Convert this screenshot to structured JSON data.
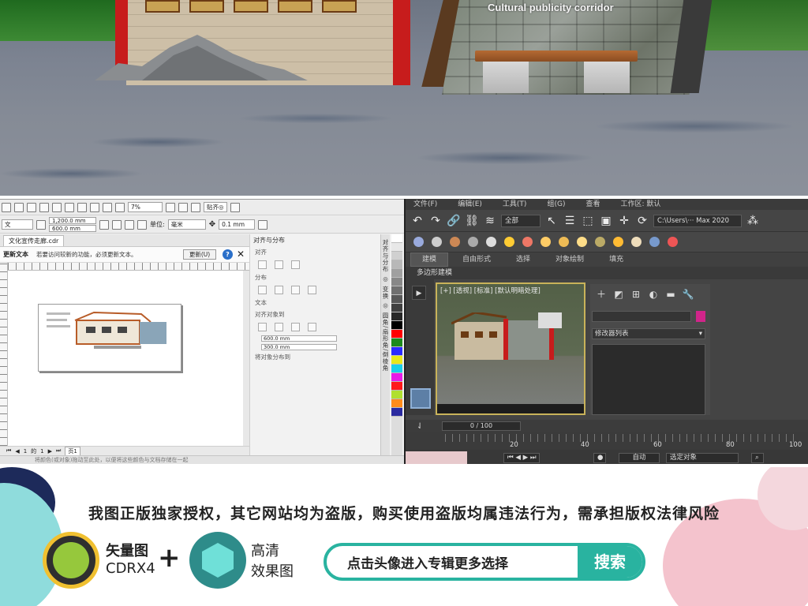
{
  "scene": {
    "caption": "Cultural publicity corridor"
  },
  "corel": {
    "toolbar": {
      "zoom": "7%",
      "align_label": "贴齐◎",
      "width": "1,200.0 mm",
      "height": "600.0 mm",
      "units_label": "单位:",
      "units_value": "毫米",
      "nudge": "0.1 mm"
    },
    "doc_tab": "文化宣传走廊.cdr",
    "notify": {
      "title": "更新文本",
      "message": "若要访问较新的功能，必须更新文本。",
      "button": "更新(U)"
    },
    "ruler_marks": [
      "200",
      "0",
      "200",
      "400",
      "600",
      "800",
      "1000",
      "1200",
      "1400"
    ],
    "pager": {
      "current": "1",
      "of": "1",
      "page_tab": "页1"
    },
    "status": "将颜色(或对象)拖动至此处，以便将这些颜色与文档存储在一起",
    "dock": {
      "title": "对齐与分布",
      "align": "对齐",
      "distribute": "分布",
      "text": "文本",
      "align_to": "对齐对象到",
      "x_value": "600.0 mm",
      "y_value": "300.0 mm",
      "distribute_to": "将对象分布到"
    },
    "dock_tabs": "对齐与分布 ◎ 变换 ◎ 圆角/扇形角/倒棱角"
  },
  "palette": [
    "#ffffff",
    "#e8e8e8",
    "#d0d0d0",
    "#b8b8b8",
    "#a0a0a0",
    "#888888",
    "#707070",
    "#585858",
    "#404040",
    "#282828",
    "#000000",
    "#ff0000",
    "#1c8a1c",
    "#2a2aff",
    "#e8e81a",
    "#1ad0e8",
    "#e81ae8",
    "#ff1a1a",
    "#b0e030",
    "#ff8c1a",
    "#2a2aa0"
  ],
  "max": {
    "menu": [
      "文件(F)",
      "编辑(E)",
      "工具(T)",
      "组(G)",
      "查看",
      "工作区: 默认"
    ],
    "filter": "全部",
    "path": "C:\\Users\\··· Max 2020",
    "ribbon_tabs": [
      "建模",
      "自由形式",
      "选择",
      "对象绘制",
      "填充"
    ],
    "ribbon_sub": "多边形建模",
    "viewport_label": "[+] [透视] [标准] [默认明暗处理]",
    "modifier_list": "修改器列表",
    "time_slider": "0 / 100",
    "track_marks": [
      "20",
      "40",
      "60",
      "80",
      "100"
    ],
    "status_auto": "自动",
    "status_selected": "选定对象"
  },
  "banner": {
    "line": "我图正版独家授权，其它网站均为盗版，购买使用盗版均属违法行为，需承担版权法律风险",
    "corel_label1": "矢量图",
    "corel_label2": "CDRX4",
    "plus": "+",
    "hd_label1": "高清",
    "hd_label2": "效果图",
    "search_prompt": "点击头像进入专辑更多选择",
    "search_button": "搜索"
  }
}
